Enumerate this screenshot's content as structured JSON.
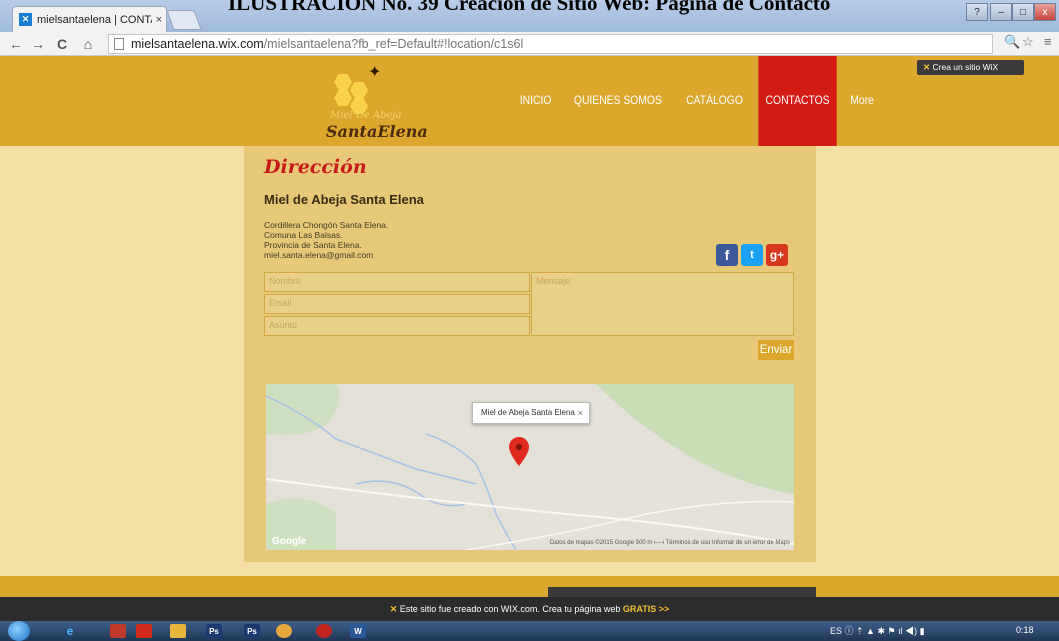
{
  "caption": "ILUSTRACIÓN No. 39 Creación de Sitio Web: Página de Contacto",
  "browser": {
    "tab_title": "mielsantaelena | CONTAC",
    "tab_close": "×",
    "url_host": "mielsantaelena.wix.com",
    "url_path": "/mielsantaelena?fb_ref=Default#!location/c1s6l",
    "nav_back": "←",
    "nav_forward": "→",
    "nav_reload": "C",
    "nav_home": "⌂",
    "zoom_icon": "🔍",
    "star_icon": "☆",
    "menu_icon": "≡",
    "win_help": "?",
    "win_min": "–",
    "win_max": "□",
    "win_close": "x"
  },
  "site": {
    "logo_line1": "Miel De Abeja",
    "logo_line2": "SantaElena",
    "menu": [
      "INICIO",
      "QUIENES SOMOS",
      "CATÁLOGO",
      "CONTACTOS",
      "More"
    ],
    "active_menu": "CONTACTOS",
    "wix_badge": "Crea un sitio WiX",
    "title": "Dirección",
    "company": "Miel de Abeja Santa Elena",
    "address_lines": [
      "Cordillera Chongón Santa Elena.",
      "Comuna Las Balsas.",
      "Provincia de Santa Elena.",
      "miel.santa.elena@gmail.com"
    ],
    "social": [
      "f",
      "t",
      "g+"
    ],
    "form": {
      "name_placeholder": "Nombre",
      "email_placeholder": "Email",
      "subject_placeholder": "Asunto",
      "message_placeholder": "Mensaje",
      "send_label": "Enviar"
    },
    "map": {
      "info_title": "Miel de Abeja Santa Elena",
      "info_close": "×",
      "attribution": "Datos de mapas ©2015 Google   500 m ⟝⟞   Términos de uso   Informar de un error de Maps",
      "google_label": "Google"
    }
  },
  "wix_bar": {
    "text": "Este sitio fue creado con WIX.com. Crea tu página web",
    "cta": "GRATIS >>"
  },
  "taskbar": {
    "tray_text": "ES",
    "clock": "0:18"
  },
  "colors": {
    "header": "#dba72d",
    "active_menu": "#d41a14",
    "title": "#c8191a",
    "facebook": "#3b5998",
    "twitter": "#1da1f2",
    "googleplus": "#d6361c"
  }
}
